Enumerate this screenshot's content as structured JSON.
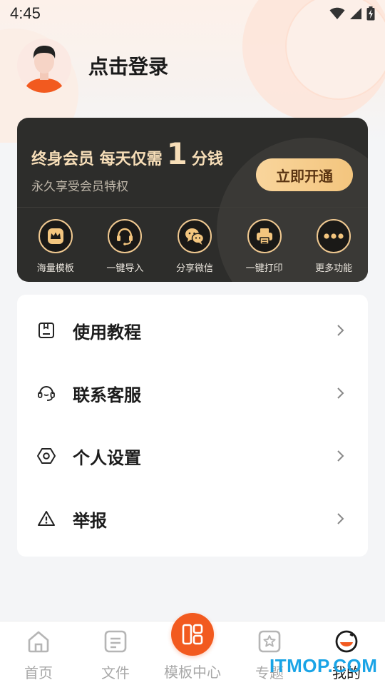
{
  "status_bar": {
    "time": "4:45"
  },
  "profile": {
    "login_label": "点击登录"
  },
  "vip": {
    "title_prefix": "终身会员 每天仅需",
    "title_number": "1",
    "title_suffix": "分钱",
    "subtitle": "永久享受会员特权",
    "button_label": "立即开通",
    "features": [
      {
        "label": "海量模板",
        "icon": "crown-icon"
      },
      {
        "label": "一键导入",
        "icon": "headset-icon"
      },
      {
        "label": "分享微信",
        "icon": "wechat-icon"
      },
      {
        "label": "一键打印",
        "icon": "printer-icon"
      },
      {
        "label": "更多功能",
        "icon": "more-icon"
      }
    ],
    "accent_color": "#f3c57e"
  },
  "menu": [
    {
      "label": "使用教程",
      "icon": "tutorial-icon"
    },
    {
      "label": "联系客服",
      "icon": "customer-service-icon"
    },
    {
      "label": "个人设置",
      "icon": "settings-icon"
    },
    {
      "label": "举报",
      "icon": "report-icon"
    }
  ],
  "bottom_nav": {
    "items": [
      {
        "label": "首页",
        "icon": "home-icon"
      },
      {
        "label": "文件",
        "icon": "file-icon"
      },
      {
        "label": "模板中心",
        "icon": "template-center-icon"
      },
      {
        "label": "专题",
        "icon": "topic-star-icon"
      },
      {
        "label": "我的",
        "icon": "profile-icon",
        "active": true
      }
    ],
    "brand_color": "#f25a1f"
  },
  "watermark": "ITMOP.COM"
}
